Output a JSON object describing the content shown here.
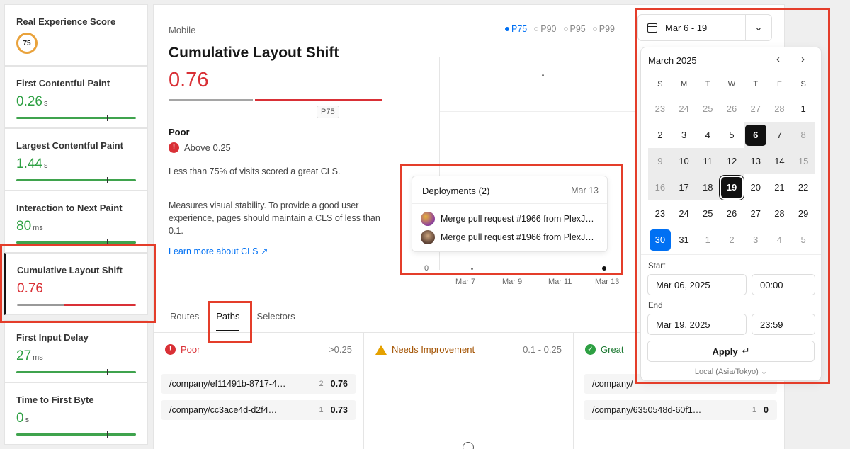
{
  "sidebar": {
    "score": {
      "label": "Real Experience Score",
      "value": "75"
    },
    "metrics": [
      {
        "label": "First Contentful Paint",
        "value": "0.26",
        "unit": "s"
      },
      {
        "label": "Largest Contentful Paint",
        "value": "1.44",
        "unit": "s"
      },
      {
        "label": "Interaction to Next Paint",
        "value": "80",
        "unit": "ms"
      },
      {
        "label": "Cumulative Layout Shift",
        "value": "0.76",
        "unit": ""
      },
      {
        "label": "First Input Delay",
        "value": "27",
        "unit": "ms"
      },
      {
        "label": "Time to First Byte",
        "value": "0",
        "unit": "s"
      }
    ]
  },
  "main": {
    "platform": "Mobile",
    "title": "Cumulative Layout Shift",
    "value": "0.76",
    "marker_label": "P75",
    "status": "Poor",
    "threshold": "Above 0.25",
    "summary": "Less than 75% of visits scored a great CLS.",
    "description": "Measures visual stability. To provide a good user experience, pages should maintain a CLS of less than 0.1.",
    "learn_more": "Learn more about CLS",
    "percentiles": [
      "P75",
      "P90",
      "P95",
      "P99"
    ],
    "chart": {
      "y_zero": "0",
      "x_labels": [
        "Mar 7",
        "Mar 9",
        "Mar 11",
        "Mar 13"
      ]
    },
    "deployments": {
      "title": "Deployments (2)",
      "date": "Mar 13",
      "items": [
        "Merge pull request #1966 from PlexJ…",
        "Merge pull request #1966 from PlexJ…"
      ]
    },
    "tabs": [
      "Routes",
      "Paths",
      "Selectors"
    ],
    "columns": {
      "poor": {
        "label": "Poor",
        "range": ">0.25",
        "rows": [
          {
            "path": "/company/ef11491b-8717-4…",
            "count": "2",
            "value": "0.76"
          },
          {
            "path": "/company/cc3ace4d-d2f4…",
            "count": "1",
            "value": "0.73"
          }
        ]
      },
      "needs": {
        "label": "Needs Improvement",
        "range": "0.1 - 0.25"
      },
      "great": {
        "label": "Great",
        "rows": [
          {
            "path": "/company/",
            "count": "",
            "value": ""
          },
          {
            "path": "/company/6350548d-60f1…",
            "count": "1",
            "value": "0"
          }
        ]
      }
    }
  },
  "date_picker": {
    "range_label": "Mar 6 - 19",
    "month": "March 2025",
    "weekdays": [
      "S",
      "M",
      "T",
      "W",
      "T",
      "F",
      "S"
    ],
    "days": [
      "23",
      "24",
      "25",
      "26",
      "27",
      "28",
      "1",
      "2",
      "3",
      "4",
      "5",
      "6",
      "7",
      "8",
      "9",
      "10",
      "11",
      "12",
      "13",
      "14",
      "15",
      "16",
      "17",
      "18",
      "19",
      "20",
      "21",
      "22",
      "23",
      "24",
      "25",
      "26",
      "27",
      "28",
      "29",
      "30",
      "31",
      "1",
      "2",
      "3",
      "4",
      "5"
    ],
    "start_label": "Start",
    "start_date": "Mar 06, 2025",
    "start_time": "00:00",
    "end_label": "End",
    "end_date": "Mar 19, 2025",
    "end_time": "23:59",
    "apply": "Apply",
    "apply_hint": "↵",
    "timezone": "Local (Asia/Tokyo)"
  },
  "colors": {
    "poor": "#d93036",
    "good": "#2ea043",
    "accent": "#0070f3",
    "highlight": "#e43d2a"
  }
}
